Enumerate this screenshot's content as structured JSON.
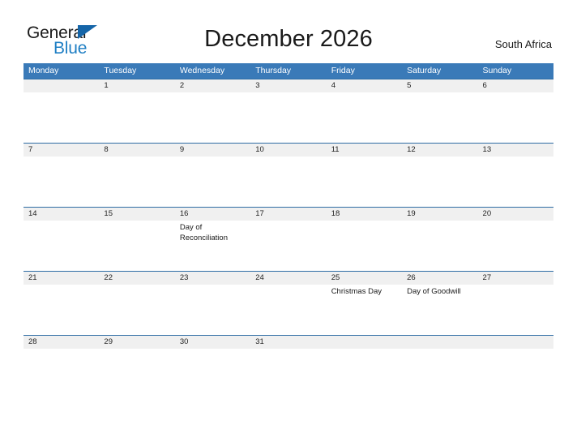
{
  "logo": {
    "word_top": "General",
    "word_bottom": "Blue",
    "flag_icon": "blue-triangle-flag",
    "color_dark": "#1a1a1a",
    "color_blue": "#1f7fc4"
  },
  "header": {
    "title": "December 2026",
    "region": "South Africa"
  },
  "calendar": {
    "accent_color": "#3a7ab8",
    "band_color": "#f0f0f0",
    "rule_color": "#2e6ca4",
    "weekdays": [
      "Monday",
      "Tuesday",
      "Wednesday",
      "Thursday",
      "Friday",
      "Saturday",
      "Sunday"
    ],
    "weeks": [
      [
        {
          "date": "",
          "event": ""
        },
        {
          "date": "1",
          "event": ""
        },
        {
          "date": "2",
          "event": ""
        },
        {
          "date": "3",
          "event": ""
        },
        {
          "date": "4",
          "event": ""
        },
        {
          "date": "5",
          "event": ""
        },
        {
          "date": "6",
          "event": ""
        }
      ],
      [
        {
          "date": "7",
          "event": ""
        },
        {
          "date": "8",
          "event": ""
        },
        {
          "date": "9",
          "event": ""
        },
        {
          "date": "10",
          "event": ""
        },
        {
          "date": "11",
          "event": ""
        },
        {
          "date": "12",
          "event": ""
        },
        {
          "date": "13",
          "event": ""
        }
      ],
      [
        {
          "date": "14",
          "event": ""
        },
        {
          "date": "15",
          "event": ""
        },
        {
          "date": "16",
          "event": "Day of Reconciliation"
        },
        {
          "date": "17",
          "event": ""
        },
        {
          "date": "18",
          "event": ""
        },
        {
          "date": "19",
          "event": ""
        },
        {
          "date": "20",
          "event": ""
        }
      ],
      [
        {
          "date": "21",
          "event": ""
        },
        {
          "date": "22",
          "event": ""
        },
        {
          "date": "23",
          "event": ""
        },
        {
          "date": "24",
          "event": ""
        },
        {
          "date": "25",
          "event": "Christmas Day"
        },
        {
          "date": "26",
          "event": "Day of Goodwill"
        },
        {
          "date": "27",
          "event": ""
        }
      ],
      [
        {
          "date": "28",
          "event": ""
        },
        {
          "date": "29",
          "event": ""
        },
        {
          "date": "30",
          "event": ""
        },
        {
          "date": "31",
          "event": ""
        },
        {
          "date": "",
          "event": ""
        },
        {
          "date": "",
          "event": ""
        },
        {
          "date": "",
          "event": ""
        }
      ]
    ]
  }
}
